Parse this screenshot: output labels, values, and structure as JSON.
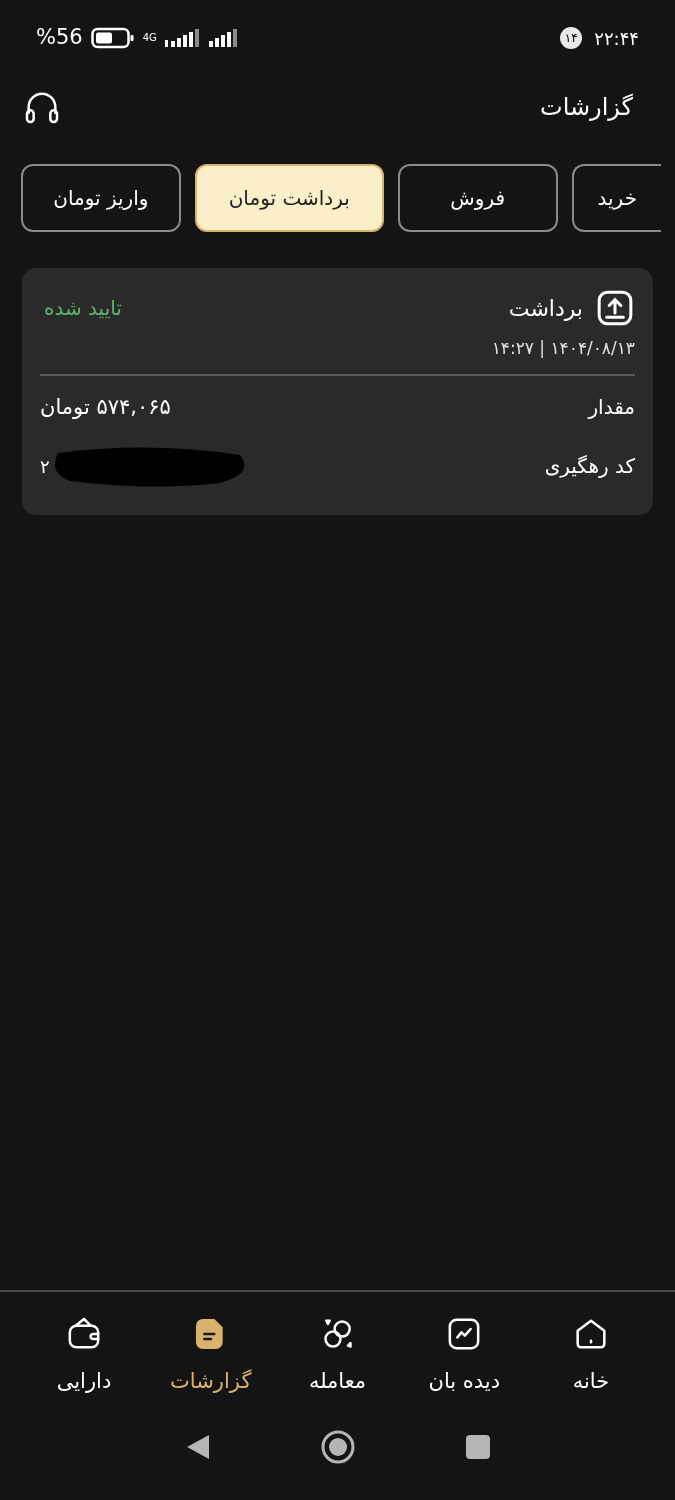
{
  "status_bar": {
    "time": "۲۲:۴۴",
    "notification_count": "۱۴",
    "battery": "%56",
    "network": "4G"
  },
  "header": {
    "title": "گزارشات"
  },
  "tabs": [
    {
      "label": "خرید",
      "selected": false
    },
    {
      "label": "فروش",
      "selected": false
    },
    {
      "label": "برداشت تومان",
      "selected": true
    },
    {
      "label": "واریز تومان",
      "selected": false
    }
  ],
  "transactions": [
    {
      "title": "برداشت",
      "status": "تایید شده",
      "datetime": "۱۴۰۴/۰۸/۱۳ | ۱۴:۲۷",
      "amount_label": "مقدار",
      "amount": "۵۷۴,۰۶۵ تومان",
      "tracking_label": "کد رهگیری",
      "tracking_code": "۲",
      "tracking_redacted": true
    }
  ],
  "bottom_nav": [
    {
      "label": "خانه",
      "kind": "home",
      "selected": false
    },
    {
      "label": "دیده بان",
      "kind": "chart",
      "selected": false
    },
    {
      "label": "معامله",
      "kind": "circles",
      "selected": false
    },
    {
      "label": "گزارشات",
      "kind": "report",
      "selected": true
    },
    {
      "label": "دارایی",
      "kind": "wallet",
      "selected": false
    }
  ]
}
